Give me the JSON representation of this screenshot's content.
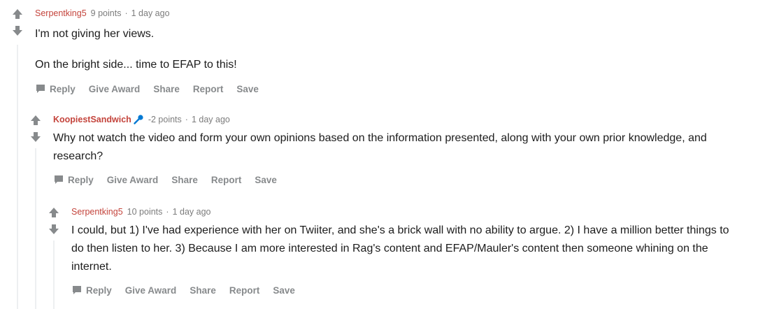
{
  "comments": [
    {
      "author": "Serpentking5",
      "points": "9 points",
      "time": "1 day ago",
      "paragraphs": [
        "I'm not giving her views.",
        "On the bright side... time to EFAP to this!"
      ]
    },
    {
      "author": "KoopiestSandwich",
      "points": "-2 points",
      "time": "1 day ago",
      "flair_icon": "microphone-icon",
      "paragraphs": [
        "Why not watch the video and form your own opinions based on the information presented, along with your own prior knowledge, and research?"
      ]
    },
    {
      "author": "Serpentking5",
      "points": "10 points",
      "time": "1 day ago",
      "paragraphs": [
        "I could, but 1) I've had experience with her on Twiiter, and she's a brick wall with no ability to argue. 2) I have a million better things to do then listen to her. 3) Because I am more interested in Rag's content and EFAP/Mauler's content then someone whining on the internet."
      ]
    }
  ],
  "actions": {
    "reply": "Reply",
    "give_award": "Give Award",
    "share": "Share",
    "report": "Report",
    "save": "Save"
  },
  "separator": "·",
  "colors": {
    "author": "#c4443c",
    "meta": "#7c7c7c",
    "action": "#878a8c",
    "vote_arrow": "#878a8c",
    "thread_line": "#edeff1",
    "mic_icon": "#0079d3"
  }
}
